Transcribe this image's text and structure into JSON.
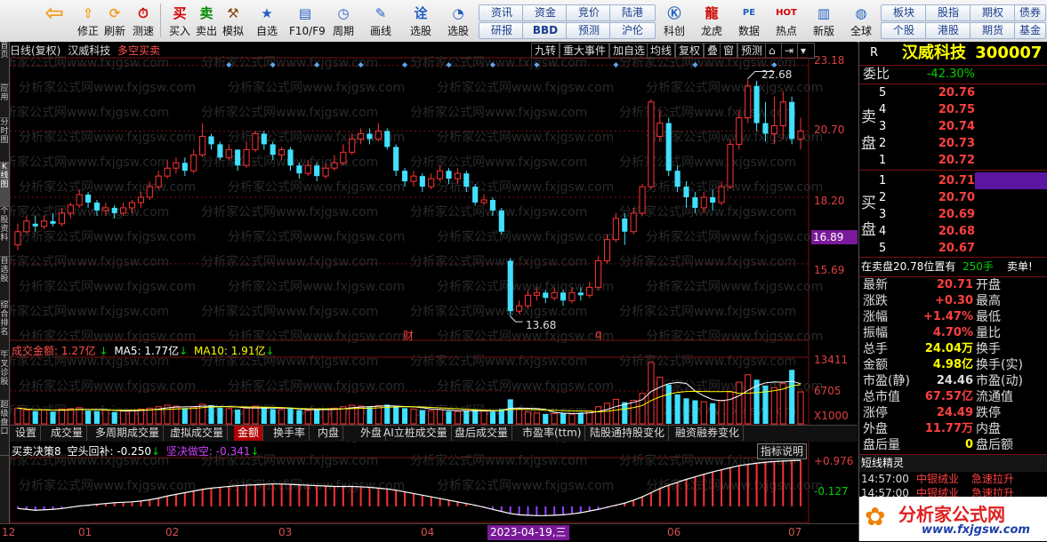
{
  "toolbar": {
    "buttons": [
      {
        "id": "back",
        "label": "",
        "icon": "back-arrow-icon",
        "glyph": "⇦",
        "color": "#f0a020"
      },
      {
        "id": "buy",
        "label": "买入",
        "icon": "buy-icon",
        "glyph": "买",
        "color": "#d00000"
      },
      {
        "id": "sell",
        "label": "卖出",
        "icon": "sell-icon",
        "glyph": "卖",
        "color": "#008800"
      },
      {
        "id": "sim",
        "label": "模拟",
        "icon": "hammer-icon",
        "glyph": "⚒",
        "color": "#8a4a10"
      },
      {
        "id": "fav",
        "label": "自选",
        "icon": "star-icon",
        "glyph": "★",
        "color": "#2060c0"
      },
      {
        "id": "f10",
        "label": "F10/F9",
        "icon": "info-card-icon",
        "glyph": "▤",
        "color": "#2060c0"
      },
      {
        "id": "period",
        "label": "周期",
        "icon": "clock-icon",
        "glyph": "◷",
        "color": "#2060c0"
      },
      {
        "id": "draw",
        "label": "画线",
        "icon": "pencil-icon",
        "glyph": "✎",
        "color": "#2060c0"
      },
      {
        "id": "pick",
        "label": "选股",
        "icon": "pick-icon",
        "glyph": "诠",
        "color": "#2060c0"
      },
      {
        "id": "screen",
        "label": "选股",
        "icon": "gauge-icon",
        "glyph": "◔",
        "color": "#2060c0"
      },
      {
        "id": "kc",
        "label": "科创",
        "icon": "kc-icon",
        "glyph": "Ⓚ",
        "color": "#2060c0"
      },
      {
        "id": "dragon",
        "label": "龙虎",
        "icon": "dragon-icon",
        "glyph": "龍",
        "color": "#d00000"
      },
      {
        "id": "data",
        "label": "数据",
        "icon": "pe-icon",
        "glyph": "PE",
        "color": "#2060c0"
      },
      {
        "id": "hot",
        "label": "热点",
        "icon": "hot-icon",
        "glyph": "HOT",
        "color": "#d00000"
      },
      {
        "id": "newver",
        "label": "新版",
        "icon": "new-version-icon",
        "glyph": "▥",
        "color": "#2060c0"
      },
      {
        "id": "global",
        "label": "全球",
        "icon": "globe-icon",
        "glyph": "◍",
        "color": "#2060c0"
      }
    ],
    "updown": {
      "up": "修正",
      "refresh": "测速",
      "icon1": "up-arrow-icon",
      "icon2": "refresh-icon",
      "icon3": "stopwatch-icon",
      "lbl2": "刷新"
    },
    "grid": [
      [
        "资讯",
        "资金",
        "竞价",
        "陆港"
      ],
      [
        "研报",
        "BBD",
        "预测",
        "沪伦"
      ]
    ],
    "grid_right": [
      [
        "板块",
        "股指",
        "期权",
        "债券"
      ],
      [
        "个股",
        "港股",
        "期货",
        "基金"
      ]
    ]
  },
  "left_tabs": [
    "首页",
    "应用",
    "分时图",
    "K线图",
    "个股资料",
    "自选股",
    "综合排名",
    "牛叉诊股",
    "超级盘口"
  ],
  "chart": {
    "header": {
      "type": "日线(复权)",
      "name": "汉威科技",
      "indicator": "多空买卖"
    },
    "top_buttons": [
      "九转",
      "重大事件",
      "加自选",
      "均线",
      "复权",
      "叠",
      "窗",
      "预测"
    ],
    "price_ticks": [
      "23.18",
      "20.70",
      "18.20",
      "15.69"
    ],
    "current_price_label": "16.89",
    "high_label": "22.68",
    "low_label": "13.68",
    "marker_cai": "财",
    "marker_q": "q",
    "volume": {
      "label": "成交金额:",
      "value": "1.27亿",
      "ma5_label": "MA5:",
      "ma5": "1.77亿",
      "ma10_label": "MA10:",
      "ma10": "1.91亿",
      "ticks": [
        "13411",
        "6705"
      ],
      "unit": "X1000"
    },
    "tabs": [
      "设置",
      "成交量",
      "多周期成交量",
      "虚拟成交量",
      "金额",
      "换手率",
      "内盘",
      "外盘",
      "AI立桩成交量",
      "盘后成交量",
      "市盈率(ttm)",
      "陆股通持股变化",
      "融资融券变化"
    ],
    "active_tab": "金额",
    "indicator": {
      "name": "买卖决策8",
      "l1_label": "空头回补:",
      "l1": "-0.250",
      "l2_label": "坚决做空:",
      "l2": "-0.341",
      "ticks": [
        "+0.976",
        "-0.127"
      ],
      "explain": "指标说明"
    },
    "xaxis": [
      "12",
      "01",
      "02",
      "03",
      "04",
      "05",
      "06",
      "07"
    ],
    "xaxis_highlight": "2023-04-19,三",
    "watermark": "分析家公式网www.fxjgsw.com"
  },
  "chart_data": {
    "type": "candlestick",
    "title": "汉威科技 日线(复权)",
    "price_range": [
      13.0,
      23.4
    ],
    "candles": [
      [
        16.4,
        16.9,
        16.2,
        17.2
      ],
      [
        16.9,
        17.3,
        16.8,
        17.5
      ],
      [
        17.2,
        17.1,
        16.9,
        17.5
      ],
      [
        17.1,
        17.3,
        17.0,
        17.5
      ],
      [
        17.3,
        17.2,
        17.1,
        17.6
      ],
      [
        17.2,
        17.6,
        17.1,
        17.8
      ],
      [
        17.6,
        17.9,
        17.4,
        18.0
      ],
      [
        17.9,
        18.3,
        17.8,
        18.5
      ],
      [
        18.3,
        18.0,
        17.8,
        18.4
      ],
      [
        18.0,
        17.7,
        17.5,
        18.1
      ],
      [
        17.7,
        17.8,
        17.5,
        18.0
      ],
      [
        17.8,
        17.6,
        17.4,
        17.9
      ],
      [
        17.6,
        17.8,
        17.5,
        18.0
      ],
      [
        17.8,
        18.0,
        17.6,
        18.1
      ],
      [
        18.0,
        18.2,
        17.8,
        18.4
      ],
      [
        18.2,
        18.6,
        18.1,
        18.8
      ],
      [
        18.6,
        19.0,
        18.5,
        19.2
      ],
      [
        19.0,
        19.3,
        18.9,
        19.6
      ],
      [
        19.3,
        19.5,
        19.1,
        19.7
      ],
      [
        19.5,
        19.2,
        19.0,
        19.7
      ],
      [
        19.2,
        19.8,
        19.1,
        20.0
      ],
      [
        19.8,
        20.5,
        19.7,
        21.0
      ],
      [
        20.5,
        20.2,
        20.0,
        20.6
      ],
      [
        20.2,
        19.7,
        19.6,
        20.3
      ],
      [
        19.7,
        20.0,
        19.6,
        20.2
      ],
      [
        20.0,
        19.4,
        19.2,
        20.0
      ],
      [
        19.4,
        20.0,
        19.3,
        20.3
      ],
      [
        20.0,
        20.6,
        19.9,
        20.7
      ],
      [
        20.6,
        20.2,
        20.0,
        20.7
      ],
      [
        20.2,
        19.8,
        19.6,
        20.3
      ],
      [
        19.8,
        20.0,
        19.6,
        20.1
      ],
      [
        20.0,
        19.4,
        19.2,
        20.1
      ],
      [
        19.4,
        19.1,
        18.9,
        19.5
      ],
      [
        19.1,
        19.4,
        19.0,
        19.6
      ],
      [
        19.4,
        19.0,
        18.8,
        19.5
      ],
      [
        19.0,
        19.3,
        18.9,
        19.5
      ],
      [
        19.3,
        19.5,
        19.2,
        19.8
      ],
      [
        19.5,
        19.9,
        19.4,
        20.2
      ],
      [
        19.9,
        20.4,
        19.8,
        20.6
      ],
      [
        20.4,
        20.6,
        20.2,
        20.8
      ],
      [
        20.6,
        20.4,
        20.2,
        20.8
      ],
      [
        20.4,
        20.7,
        20.3,
        21.0
      ],
      [
        20.7,
        20.1,
        20.0,
        20.8
      ],
      [
        20.1,
        19.2,
        19.0,
        20.2
      ],
      [
        19.2,
        18.8,
        18.6,
        19.3
      ],
      [
        18.8,
        19.0,
        18.6,
        19.2
      ],
      [
        19.0,
        18.6,
        18.4,
        19.1
      ],
      [
        18.6,
        18.9,
        18.5,
        19.1
      ],
      [
        18.9,
        19.2,
        18.8,
        19.4
      ],
      [
        19.2,
        18.9,
        18.7,
        19.3
      ],
      [
        18.9,
        19.1,
        18.7,
        19.3
      ],
      [
        19.1,
        18.6,
        18.4,
        19.2
      ],
      [
        18.6,
        18.0,
        17.9,
        18.7
      ],
      [
        18.0,
        18.1,
        17.9,
        18.3
      ],
      [
        18.1,
        17.7,
        17.5,
        18.2
      ],
      [
        17.7,
        16.9,
        16.8,
        17.8
      ],
      [
        15.8,
        13.9,
        13.7,
        15.9
      ],
      [
        13.9,
        14.1,
        13.8,
        14.3
      ],
      [
        14.1,
        14.5,
        14.0,
        14.7
      ],
      [
        14.5,
        14.6,
        14.3,
        14.8
      ],
      [
        14.6,
        14.4,
        14.2,
        14.7
      ],
      [
        14.4,
        14.6,
        14.3,
        14.8
      ],
      [
        14.6,
        14.3,
        14.1,
        14.7
      ],
      [
        14.3,
        14.6,
        14.2,
        14.8
      ],
      [
        14.6,
        14.5,
        14.3,
        14.8
      ],
      [
        14.5,
        14.8,
        14.4,
        15.0
      ],
      [
        14.8,
        15.8,
        14.7,
        16.0
      ],
      [
        15.8,
        16.6,
        15.7,
        16.8
      ],
      [
        16.6,
        17.4,
        16.5,
        17.6
      ],
      [
        17.4,
        16.9,
        16.4,
        17.6
      ],
      [
        16.9,
        17.6,
        16.8,
        17.8
      ],
      [
        17.6,
        18.6,
        17.5,
        18.7
      ],
      [
        18.6,
        21.8,
        18.5,
        21.9
      ],
      [
        20.5,
        21.0,
        20.3,
        21.5
      ],
      [
        21.0,
        19.2,
        19.0,
        21.2
      ],
      [
        19.2,
        18.6,
        18.4,
        19.4
      ],
      [
        18.6,
        18.2,
        17.8,
        18.8
      ],
      [
        18.2,
        17.8,
        17.6,
        18.4
      ],
      [
        17.8,
        18.2,
        17.6,
        18.4
      ],
      [
        18.2,
        18.0,
        17.7,
        18.5
      ],
      [
        18.0,
        18.6,
        17.9,
        18.8
      ],
      [
        18.6,
        20.2,
        18.5,
        20.4
      ],
      [
        20.2,
        21.2,
        20.0,
        21.5
      ],
      [
        21.2,
        22.4,
        21.0,
        22.68
      ],
      [
        22.4,
        21.0,
        20.7,
        22.6
      ],
      [
        21.0,
        20.6,
        20.3,
        21.8
      ],
      [
        20.6,
        20.9,
        20.2,
        22.0
      ],
      [
        20.9,
        21.8,
        20.4,
        22.2
      ],
      [
        21.8,
        20.4,
        20.2,
        22.0
      ],
      [
        20.4,
        20.7,
        20.0,
        21.2
      ]
    ],
    "volume_amount": [
      3.2,
      2.8,
      2.6,
      2.9,
      2.5,
      3.0,
      3.1,
      3.3,
      2.7,
      2.6,
      2.8,
      2.4,
      2.6,
      2.8,
      3.0,
      3.2,
      3.5,
      3.8,
      3.6,
      3.2,
      3.4,
      4.0,
      3.8,
      3.3,
      3.1,
      2.9,
      3.2,
      3.6,
      3.4,
      3.0,
      2.9,
      3.1,
      2.8,
      2.7,
      2.9,
      3.0,
      3.2,
      3.5,
      3.8,
      3.6,
      3.4,
      3.7,
      3.9,
      3.5,
      3.2,
      3.0,
      2.8,
      2.7,
      2.9,
      2.6,
      2.5,
      2.7,
      2.8,
      2.6,
      2.5,
      3.0,
      5.0,
      3.0,
      2.4,
      2.2,
      2.0,
      2.1,
      2.2,
      2.0,
      2.3,
      2.6,
      3.5,
      4.2,
      5.0,
      4.4,
      4.8,
      6.2,
      12.5,
      9.5,
      8.0,
      6.0,
      5.2,
      4.8,
      4.5,
      4.2,
      4.8,
      6.5,
      8.5,
      10.0,
      9.0,
      7.8,
      7.4,
      8.2,
      11.0,
      6.5
    ],
    "volume_ticks": [
      13411,
      6705
    ],
    "volume_unit": "X1000",
    "indicator_range": [
      -0.45,
      1.0
    ],
    "indicator": [
      -0.18,
      -0.2,
      -0.22,
      -0.21,
      -0.2,
      -0.18,
      -0.15,
      -0.12,
      -0.1,
      -0.08,
      -0.06,
      -0.04,
      -0.03,
      -0.02,
      0.0,
      0.03,
      0.07,
      0.12,
      0.16,
      0.2,
      0.24,
      0.28,
      0.31,
      0.33,
      0.35,
      0.37,
      0.38,
      0.39,
      0.4,
      0.41,
      0.41,
      0.4,
      0.39,
      0.38,
      0.37,
      0.36,
      0.35,
      0.35,
      0.35,
      0.34,
      0.33,
      0.31,
      0.29,
      0.26,
      0.22,
      0.18,
      0.14,
      0.1,
      0.06,
      0.02,
      -0.02,
      -0.06,
      -0.1,
      -0.15,
      -0.2,
      -0.25,
      -0.3,
      -0.33,
      -0.34,
      -0.35,
      -0.35,
      -0.34,
      -0.33,
      -0.31,
      -0.28,
      -0.24,
      -0.2,
      -0.15,
      -0.1,
      -0.05,
      0.02,
      0.1,
      0.2,
      0.3,
      0.38,
      0.45,
      0.52,
      0.58,
      0.64,
      0.7,
      0.75,
      0.8,
      0.85,
      0.88,
      0.91,
      0.93,
      0.95,
      0.96,
      0.97,
      0.976
    ]
  },
  "quote": {
    "code_label": "R",
    "name": "汉威科技",
    "code": "300007",
    "webi_label": "委比",
    "webi": "-42.30%",
    "sell_label": "卖盘",
    "buy_label": "买盘",
    "asks": [
      [
        "5",
        "20.76"
      ],
      [
        "4",
        "20.75"
      ],
      [
        "3",
        "20.74"
      ],
      [
        "2",
        "20.73"
      ],
      [
        "1",
        "20.72"
      ]
    ],
    "bids": [
      [
        "1",
        "20.71"
      ],
      [
        "2",
        "20.70"
      ],
      [
        "3",
        "20.69"
      ],
      [
        "4",
        "20.68"
      ],
      [
        "5",
        "20.67"
      ]
    ],
    "note": {
      "text": "在卖盘20.78位置有",
      "qty": "250手",
      "suffix": "卖单!"
    },
    "stats": [
      [
        "最新",
        "20.71",
        "开盘",
        ""
      ],
      [
        "涨跌",
        "+0.30",
        "最高",
        ""
      ],
      [
        "涨幅",
        "+1.47%",
        "最低",
        ""
      ],
      [
        "振幅",
        "4.70%",
        "量比",
        ""
      ],
      [
        "总手",
        "24.04万",
        "换手",
        ""
      ],
      [
        "金额",
        "4.98亿",
        "换手(实)",
        ""
      ],
      [
        "市盈(静)",
        "24.46",
        "市盈(动)",
        ""
      ],
      [
        "总市值",
        "67.57亿",
        "流通值",
        ""
      ],
      [
        "涨停",
        "24.49",
        "跌停",
        ""
      ],
      [
        "外盘",
        "11.77万",
        "内盘",
        ""
      ],
      [
        "盘后量",
        "0",
        "盘后额",
        ""
      ]
    ],
    "flash_title": "短线精灵",
    "flash": [
      [
        "14:57:00",
        "中银绒业",
        "急速拉升"
      ],
      [
        "14:57:00",
        "中银绒业",
        "急速拉升"
      ]
    ],
    "logo_text": "分析家公式网",
    "logo_url": "www.fxjgsw.com"
  },
  "colors": {
    "up": "#ff3333",
    "down": "#40e0ff",
    "grid": "#7a1010",
    "ma5": "#ffffff",
    "ma10": "#ffff00",
    "accent": "#ff4040"
  }
}
